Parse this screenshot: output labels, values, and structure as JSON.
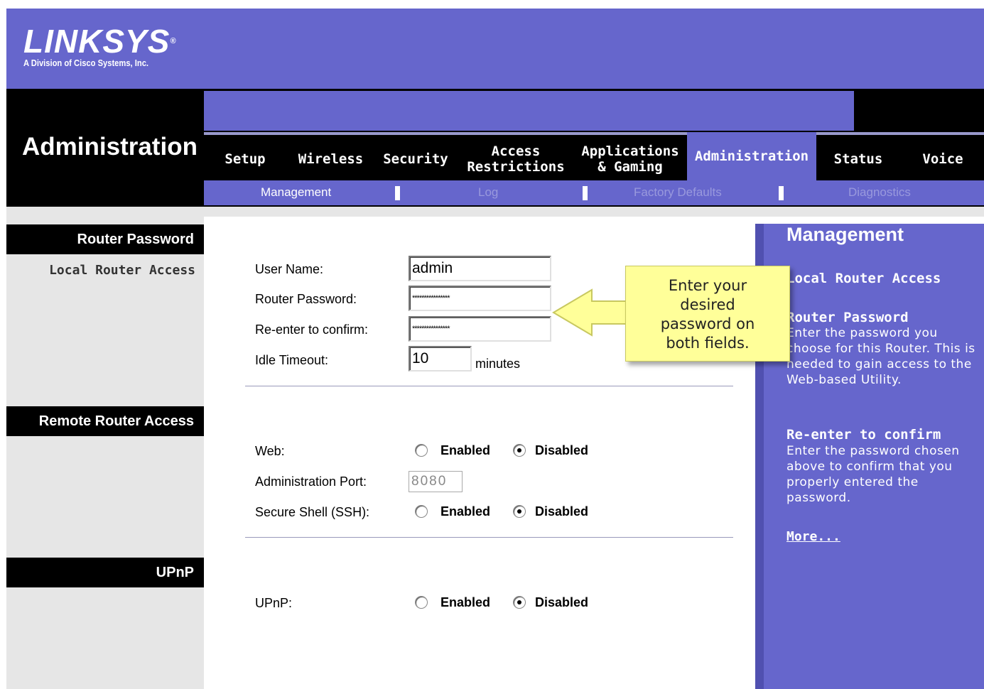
{
  "brand": {
    "logo_text": "LINKSYS",
    "logo_mark": "®",
    "subtitle": "A Division of Cisco Systems, Inc."
  },
  "section_title": "Administration",
  "tabs": [
    {
      "label": "Setup",
      "active": false
    },
    {
      "label": "Wireless",
      "active": false
    },
    {
      "label": "Security",
      "active": false
    },
    {
      "label": "Access Restrictions",
      "active": false
    },
    {
      "label": "Applications & Gaming",
      "active": false
    },
    {
      "label": "Administration",
      "active": true
    },
    {
      "label": "Status",
      "active": false
    },
    {
      "label": "Voice",
      "active": false
    }
  ],
  "subtabs": [
    {
      "label": "Management",
      "active": true
    },
    {
      "label": "Log",
      "active": false
    },
    {
      "label": "Factory Defaults",
      "active": false
    },
    {
      "label": "Diagnostics",
      "active": false
    }
  ],
  "left": {
    "router_password": "Router Password",
    "local_router_access": "Local Router Access",
    "remote_router_access": "Remote Router Access",
    "upnp": "UPnP"
  },
  "form": {
    "user_name_label": "User Name:",
    "user_name_value": "admin",
    "router_password_label": "Router Password:",
    "router_password_value": "****************",
    "reenter_label": "Re-enter to confirm:",
    "reenter_value": "****************",
    "idle_timeout_label": "Idle Timeout:",
    "idle_timeout_value": "10",
    "idle_timeout_unit": "minutes",
    "web_label": "Web:",
    "admin_port_label": "Administration Port:",
    "admin_port_value": "8080",
    "ssh_label": "Secure Shell (SSH):",
    "upnp_label": "UPnP:",
    "enabled_label": "Enabled",
    "disabled_label": "Disabled",
    "web_selected": "Disabled",
    "ssh_selected": "Disabled",
    "upnp_selected": "Disabled"
  },
  "callout": {
    "lines": [
      "Enter your",
      "desired",
      "password on",
      "both fields."
    ],
    "color": "#ffff99"
  },
  "help": {
    "title": "Management",
    "local_router_access": "Local Router Access",
    "router_password_heading": "Router Password",
    "router_password_text": "Enter the password you choose for this Router. This is needed to gain access to the Web-based Utility.",
    "reenter_heading": "Re-enter to confirm",
    "reenter_text": "Enter the password chosen above to confirm that you properly entered the password.",
    "more_link": "More..."
  },
  "colors": {
    "brand_purple": "#6666cc",
    "black": "#000000",
    "panel_gray": "#e6e6e6"
  }
}
